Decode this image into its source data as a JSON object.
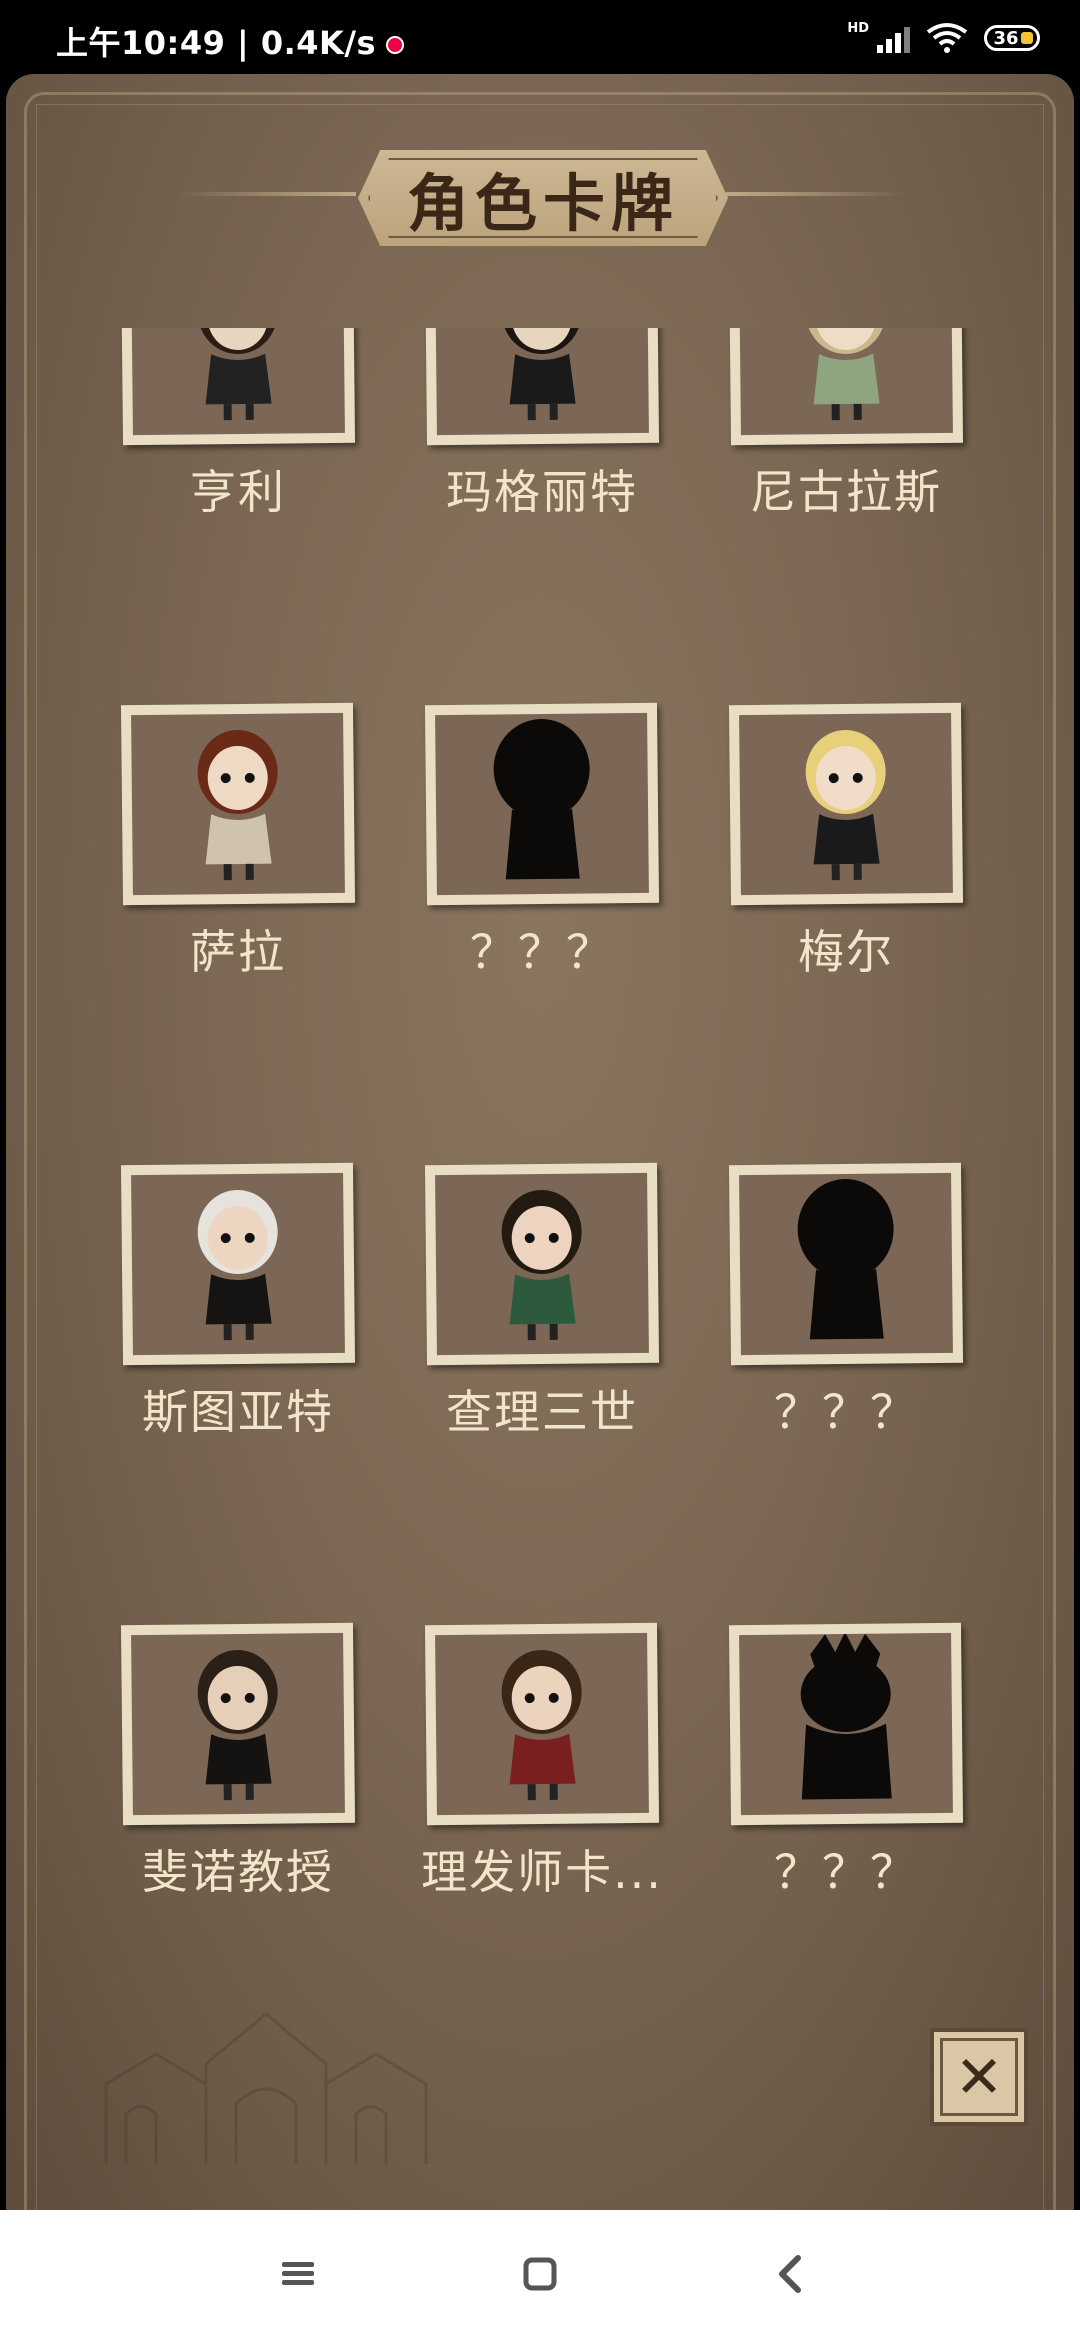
{
  "status_bar": {
    "time_speed": "上午10:49 | 0.4K/s",
    "network_label": "HD",
    "battery": "36"
  },
  "panel": {
    "title": "角色卡牌"
  },
  "cards": [
    {
      "name": "亨利",
      "locked": false,
      "icon": "henry-portrait"
    },
    {
      "name": "玛格丽特",
      "locked": false,
      "icon": "margaret-portrait"
    },
    {
      "name": "尼古拉斯",
      "locked": false,
      "icon": "nicholas-portrait"
    },
    {
      "name": "萨拉",
      "locked": false,
      "icon": "sarah-portrait"
    },
    {
      "name": "？？？",
      "locked": true,
      "icon": "silhouette"
    },
    {
      "name": "梅尔",
      "locked": false,
      "icon": "mel-portrait"
    },
    {
      "name": "斯图亚特",
      "locked": false,
      "icon": "stuart-portrait"
    },
    {
      "name": "查理三世",
      "locked": false,
      "icon": "charles-portrait"
    },
    {
      "name": "？？？",
      "locked": true,
      "icon": "silhouette"
    },
    {
      "name": "斐诺教授",
      "locked": false,
      "icon": "professor-portrait"
    },
    {
      "name": "理发师卡...",
      "locked": false,
      "icon": "barber-portrait"
    },
    {
      "name": "？？？",
      "locked": true,
      "icon": "crowned-silhouette"
    }
  ],
  "controls": {
    "close_icon": "close-icon"
  },
  "nav": {
    "recents_icon": "menu-icon",
    "home_icon": "home-icon",
    "back_icon": "back-icon"
  },
  "colors": {
    "panel_bg": "#7b6753",
    "card_frame": "#e9ddc3",
    "card_inner": "#7c6656",
    "label_text": "#f1e6cc",
    "title_text": "#3a2717"
  }
}
